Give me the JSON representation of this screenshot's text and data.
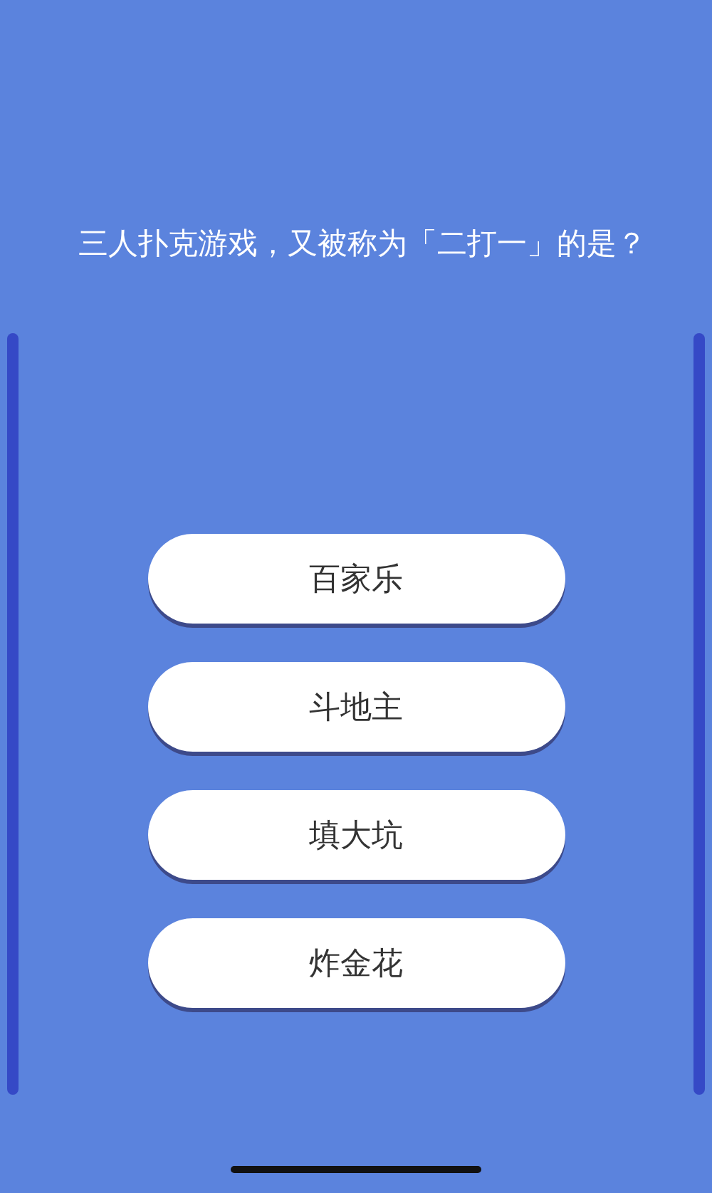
{
  "question": "三人扑克游戏，又被称为「二打一」的是？",
  "options": [
    {
      "label": "百家乐"
    },
    {
      "label": "斗地主"
    },
    {
      "label": "填大坑"
    },
    {
      "label": "炸金花"
    }
  ]
}
